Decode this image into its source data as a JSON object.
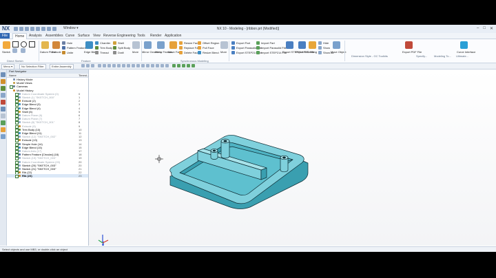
{
  "app": {
    "brand": "NX",
    "window_menu": "Window ▾",
    "title": "NX 10 - Modeling - [ribbon.prt (Modified)]",
    "window_controls": [
      "–",
      "□",
      "✕"
    ]
  },
  "tabs": [
    "File",
    "Home",
    "Analysis",
    "Assemblies",
    "Curve",
    "Surface",
    "View",
    "Reverse Engineering",
    "Tools",
    "Render",
    "Application"
  ],
  "ribbon": {
    "sketch": "Sketch",
    "direct_sketch_label": "Direct Sketch",
    "datum_plane": "Datum Plane",
    "extrude": "Extrude",
    "hole": "Hole",
    "pattern_feature": "Pattern Feature",
    "unite": "Unite",
    "edge_blend": "Edge Blend",
    "chamfer": "Chamfer",
    "trim_body": "Trim Body",
    "thread": "Thread",
    "shell": "Shell",
    "split_body": "Split Body",
    "draft": "Draft",
    "feature_label": "Feature",
    "more": "More",
    "mirror_geometry": "Mirror Geometry",
    "mirror_feature": "Mirror Feature",
    "move_face": "Move Face",
    "resize_face": "Resize Face",
    "replace_face": "Replace Face",
    "delete_face": "Delete Face",
    "offset_region": "Offset Region",
    "pull_face": "Pull Face",
    "resize_blend": "Resize Blend",
    "sync_label": "Synchronous Modeling",
    "export_part": "Export Part",
    "export_parasolid": "Export Parasolid File",
    "export_step": "Export STEP214 File",
    "import_part": "Import Part",
    "import_parasolid": "Import Parasolid File",
    "import_step": "Import STEP214 File",
    "export_stl_btn": "Export STEP214 Fle",
    "export_stl": "Export STL File",
    "drafting": "Drafting",
    "hide": "Hide",
    "show": "Show",
    "hide_all": "Show All",
    "move_object": "Move Object",
    "dimension_style": "Dimension Style - GC Toolkits",
    "export_pdf": "Export PDF File",
    "specify": "Specify...",
    "modeling": "Modeling To...",
    "curve_interface": "Curve Interface",
    "ultimate": "Ultimate..."
  },
  "selbar": {
    "menu": "Menu ▾",
    "filter": "Entire Assembly",
    "type": "No Selection Filter",
    "label": "Direct Sketch"
  },
  "navigator": {
    "title": "Part Navigator",
    "col_name": "Name",
    "col_timestamp": "Timest...",
    "items": [
      {
        "label": "History Mode",
        "num": "",
        "level": 1,
        "dim": false,
        "check": false,
        "icon": "#7b8fb0"
      },
      {
        "label": "Model Views",
        "num": "",
        "level": 1,
        "dim": false,
        "check": false,
        "icon": "#c7a14a"
      },
      {
        "label": "Cameras",
        "num": "",
        "level": 1,
        "dim": false,
        "check": true,
        "icon": "#6e7f99"
      },
      {
        "label": "Model History",
        "num": "",
        "level": 1,
        "dim": false,
        "check": false,
        "icon": "#d08f2c"
      },
      {
        "label": "Datum Coordinate System (0)",
        "num": "0",
        "level": 2,
        "dim": true,
        "check": true,
        "icon": "#8aa6c9"
      },
      {
        "label": "Sketch (1) \"SKETCH_000\"",
        "num": "1",
        "level": 2,
        "dim": true,
        "check": true,
        "icon": "#8aa6c9"
      },
      {
        "label": "Extrude (2)",
        "num": "2",
        "level": 2,
        "dim": false,
        "check": true,
        "icon": "#c58a2e"
      },
      {
        "label": "Edge Blend (3)",
        "num": "3",
        "level": 2,
        "dim": false,
        "check": true,
        "icon": "#3d8ec4"
      },
      {
        "label": "Edge Blend (4)",
        "num": "4",
        "level": 2,
        "dim": false,
        "check": true,
        "icon": "#3d8ec4"
      },
      {
        "label": "Shell (5)",
        "num": "5",
        "level": 2,
        "dim": false,
        "check": true,
        "icon": "#d0a13c"
      },
      {
        "label": "Datum Plane (6)",
        "num": "6",
        "level": 2,
        "dim": true,
        "check": true,
        "icon": "#8aa6c9"
      },
      {
        "label": "Datum Plane (7)",
        "num": "7",
        "level": 2,
        "dim": true,
        "check": true,
        "icon": "#8aa6c9"
      },
      {
        "label": "Sketch (8) \"SKETCH_001\"",
        "num": "8",
        "level": 2,
        "dim": true,
        "check": true,
        "icon": "#8aa6c9"
      },
      {
        "label": "Extrude (9)",
        "num": "9",
        "level": 2,
        "dim": true,
        "check": true,
        "icon": "#c58a2e"
      },
      {
        "label": "Trim Body (10)",
        "num": "10",
        "level": 2,
        "dim": false,
        "check": true,
        "icon": "#5f8d3a"
      },
      {
        "label": "Edge Blend (11)",
        "num": "11",
        "level": 2,
        "dim": false,
        "check": true,
        "icon": "#3d8ec4"
      },
      {
        "label": "Sketch (12) \"SKETCH_002\"",
        "num": "12",
        "level": 2,
        "dim": true,
        "check": true,
        "icon": "#8aa6c9"
      },
      {
        "label": "Extrude (13)",
        "num": "13",
        "level": 2,
        "dim": false,
        "check": true,
        "icon": "#c58a2e"
      },
      {
        "label": "Simple Hole (14)",
        "num": "14",
        "level": 2,
        "dim": false,
        "check": true,
        "icon": "#6b7fa3"
      },
      {
        "label": "Edge Blend (15)",
        "num": "15",
        "level": 2,
        "dim": false,
        "check": true,
        "icon": "#3d8ec4"
      },
      {
        "label": "Datum Axis (17)",
        "num": "17",
        "level": 2,
        "dim": true,
        "check": true,
        "icon": "#8aa6c9"
      },
      {
        "label": "Pattern Feature [Circular] (18)",
        "num": "18",
        "level": 2,
        "dim": false,
        "check": true,
        "icon": "#4d6fa6"
      },
      {
        "label": "Sketch (19) \"SKETCH_003\"",
        "num": "19",
        "level": 2,
        "dim": true,
        "check": true,
        "icon": "#8aa6c9"
      },
      {
        "label": "Datum Coordinate System (20)",
        "num": "20",
        "level": 2,
        "dim": true,
        "check": true,
        "icon": "#8aa6c9"
      },
      {
        "label": "Sketch (20) \"SKETCH_003\"",
        "num": "20",
        "level": 2,
        "dim": false,
        "check": true,
        "icon": "#8aa6c9"
      },
      {
        "label": "Sketch (21) \"SKETCH_003\"",
        "num": "21",
        "level": 2,
        "dim": false,
        "check": true,
        "icon": "#8aa6c9"
      },
      {
        "label": "Rib (22)",
        "num": "22",
        "level": 2,
        "dim": false,
        "check": true,
        "icon": "#c58a2e"
      },
      {
        "label": "Rib (23)",
        "num": "23",
        "level": 2,
        "dim": false,
        "check": true,
        "icon": "#c58a2e",
        "selected": true
      }
    ]
  },
  "status": "Select objects and use MB3, or double-click an object",
  "colors": {
    "accent": "#2f66b3",
    "part": "#7fd0dc",
    "part_dark": "#3a9fb0",
    "part_edge": "#0d2b33"
  }
}
